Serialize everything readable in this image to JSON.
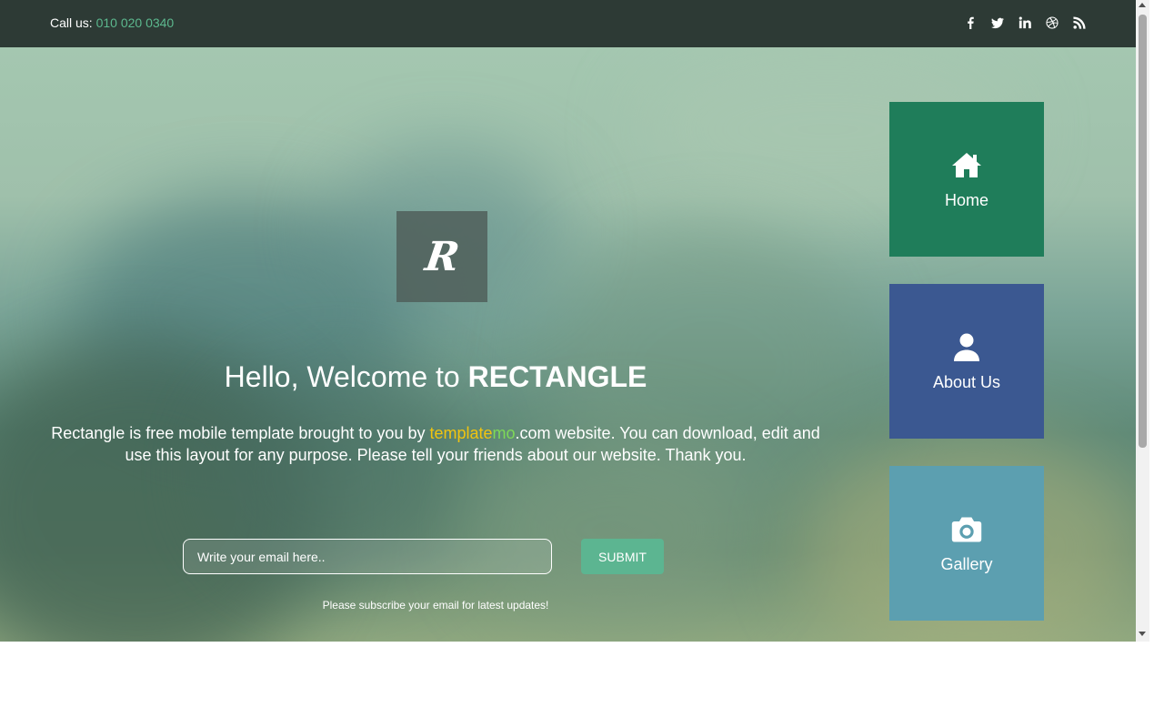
{
  "topbar": {
    "call_label": "Call us:",
    "phone": "010 020 0340",
    "social": [
      "facebook-icon",
      "twitter-icon",
      "linkedin-icon",
      "dribbble-icon",
      "rss-icon"
    ]
  },
  "logo": {
    "letter": "R"
  },
  "hero": {
    "welcome_prefix": "Hello, Welcome to ",
    "welcome_brand": "RECTANGLE",
    "intro_before": "Rectangle is free mobile template brought to you by ",
    "intro_link_part1": "template",
    "intro_link_part2": "mo",
    "intro_after": ".com website. You can download, edit and use this layout for any purpose. Please tell your friends about our website. Thank you.",
    "email_placeholder": "Write your email here..",
    "submit_label": "SUBMIT",
    "subscribe_note": "Please subscribe your email for latest updates!"
  },
  "nav_tiles": [
    {
      "label": "Home",
      "icon": "home-icon",
      "color": "#1f7d5a"
    },
    {
      "label": "About Us",
      "icon": "user-icon",
      "color": "#3b5891"
    },
    {
      "label": "Gallery",
      "icon": "camera-icon",
      "color": "#5c9fb0"
    }
  ],
  "colors": {
    "topbar_bg": "#2d3a35",
    "accent_green": "#5cb88e",
    "submit_bg": "#5cb591",
    "template_yellow": "#f1c40f",
    "mo_green": "#7ed957"
  }
}
